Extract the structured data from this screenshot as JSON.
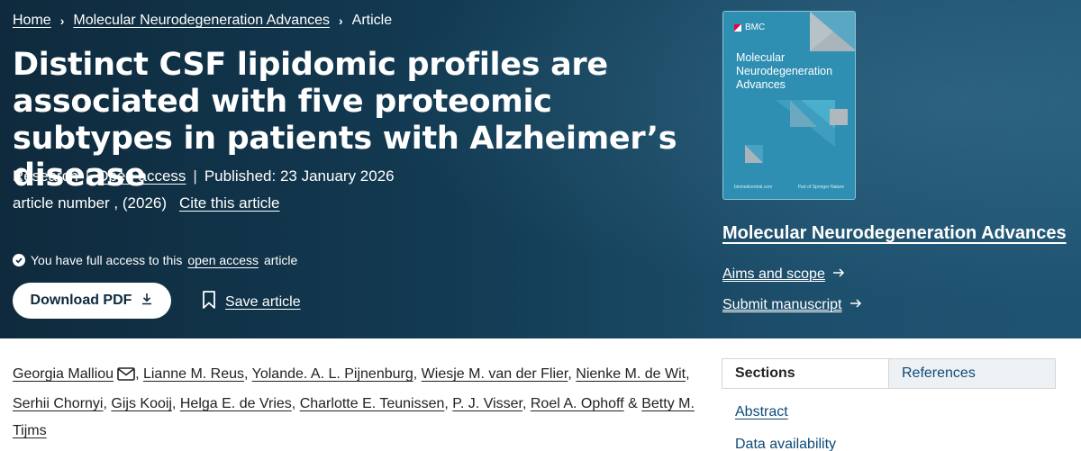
{
  "breadcrumb": {
    "home": "Home",
    "journal": "Molecular Neurodegeneration Advances",
    "current": "Article"
  },
  "article": {
    "title": "Distinct CSF lipidomic profiles are associated with five proteomic subtypes in patients with Alzheimer’s disease",
    "type": "Research",
    "access": "Open access",
    "published": "Published: 23 January 2026",
    "article_number": "article number , (2026)",
    "cite": "Cite this article"
  },
  "access_notice": {
    "prefix": "You have full access to this",
    "link": "open access",
    "suffix": "article"
  },
  "actions": {
    "download": "Download PDF",
    "save": "Save article"
  },
  "cover": {
    "brand": "BMC",
    "title": "Molecular Neurodegeneration Advances",
    "foot_left": "biomedcentral.com",
    "foot_right": "Part of Springer Nature"
  },
  "journal_panel": {
    "name": "Molecular Neurodegeneration Advances",
    "aims": "Aims and scope",
    "submit": "Submit manuscript"
  },
  "authors": [
    "Georgia Malliou",
    "Lianne M. Reus",
    "Yolande. A. L. Pijnenburg",
    "Wiesje M. van der Flier",
    "Nienke M. de Wit",
    "Serhii Chornyi",
    "Gijs Kooij",
    "Helga E. de Vries",
    "Charlotte E. Teunissen",
    "P. J. Visser",
    "Roel A. Ophoff",
    "Betty M. Tijms"
  ],
  "authors_sep": {
    "comma": ",",
    "amp": "&"
  },
  "tabs": {
    "sections": "Sections",
    "references": "References"
  },
  "sections_nav": {
    "abstract": "Abstract",
    "data": "Data availability"
  },
  "colors": {
    "hero_dark": "#0f2a3d",
    "hero_light": "#1e5472",
    "cover": "#2e8fb3",
    "link_blue": "#0c4a78"
  }
}
